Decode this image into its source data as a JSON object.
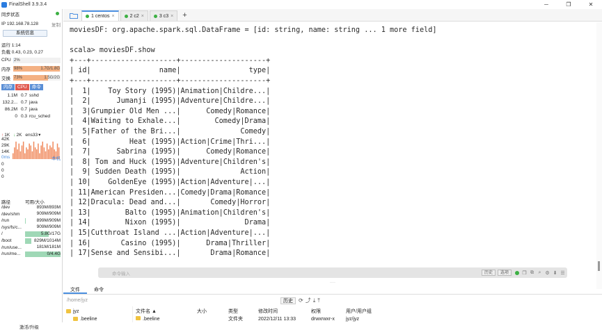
{
  "window": {
    "title": "FinalShell 3.9.3.4",
    "controls": [
      "─",
      "❐",
      "✕"
    ]
  },
  "sidebar": {
    "sync_status": "同步状态",
    "sync_dot_color": "#3cb043",
    "ip": "IP 192.168.78.128",
    "copy": "复制",
    "sysinfo_button": "系统信息",
    "uptime": "运行 1:14",
    "load": "负载 0.43, 0.23, 0.27",
    "cpu": {
      "label": "CPU",
      "value": "2%",
      "fraction": 0.02
    },
    "mem": {
      "label": "内存",
      "pct": "98%",
      "value": "1.7G/1.8G",
      "fraction": 0.98
    },
    "swap": {
      "label": "交换",
      "pct": "73%",
      "value": "1.5G/2G",
      "fraction": 0.73
    },
    "proc_tabs": [
      "内存",
      "CPU",
      "命令"
    ],
    "processes": [
      {
        "mem": "1.1M",
        "cpu": "0.7",
        "name": "sshd"
      },
      {
        "mem": "132.2...",
        "cpu": "0.7",
        "name": "java"
      },
      {
        "mem": "86.2M",
        "cpu": "0.7",
        "name": "java"
      },
      {
        "mem": "0",
        "cpu": "0.3",
        "name": "rcu_sched"
      }
    ],
    "net": {
      "up": "1K",
      "down": "2K",
      "iface": "ens33"
    },
    "net_y_labels": [
      "42K",
      "29K",
      "14K"
    ],
    "net_bars": [
      0.3,
      0.6,
      0.9,
      0.5,
      0.8,
      0.4,
      0.7,
      0.9,
      0.3,
      0.6,
      0.5,
      0.8,
      0.7,
      0.4,
      0.9,
      0.6,
      0.5,
      0.8,
      0.3,
      0.7,
      0.9,
      0.6,
      0.4,
      0.8,
      0.5,
      0.7,
      0.6,
      0.9,
      0.5,
      0.4,
      0.8,
      0.6
    ],
    "latency": {
      "value": "0ms",
      "host": "本机",
      "rows": [
        "0",
        "0",
        "0"
      ]
    },
    "disk_header": {
      "path": "路径",
      "size": "可用/大小"
    },
    "disks": [
      {
        "path": "/dev",
        "size": "893M/893M",
        "fraction": 0.0
      },
      {
        "path": "/dev/shm",
        "size": "909M/909M",
        "fraction": 0.0
      },
      {
        "path": "/run",
        "size": "899M/909M",
        "fraction": 0.01
      },
      {
        "path": "/sys/fs/c...",
        "size": "909M/909M",
        "fraction": 0.0
      },
      {
        "path": "/",
        "size": "5.8G/17G",
        "fraction": 0.66
      },
      {
        "path": "/boot",
        "size": "829M/1014M",
        "fraction": 0.18
      },
      {
        "path": "/run/use...",
        "size": "181M/181M",
        "fraction": 0.0
      },
      {
        "path": "/run/me...",
        "size": "0/4.4G",
        "fraction": 1.0
      }
    ],
    "activate": "激活/升级"
  },
  "tabs": [
    {
      "label": "1 centos",
      "active": true
    },
    {
      "label": "2 c2",
      "active": false
    },
    {
      "label": "3 c3",
      "active": false
    }
  ],
  "terminal": {
    "lines": [
      "moviesDF: org.apache.spark.sql.DataFrame = [id: string, name: string ... 1 more field]",
      "",
      "scala> moviesDF.show",
      "+---+--------------------+--------------------+",
      "| id|                name|                type|",
      "+---+--------------------+--------------------+",
      "|  1|    Toy Story (1995)|Animation|Childre...|",
      "|  2|      Jumanji (1995)|Adventure|Childre...|",
      "|  3|Grumpier Old Men ...|      Comedy|Romance|",
      "|  4|Waiting to Exhale...|        Comedy|Drama|",
      "|  5|Father of the Bri...|              Comedy|",
      "|  6|         Heat (1995)|Action|Crime|Thri...|",
      "|  7|      Sabrina (1995)|      Comedy|Romance|",
      "|  8| Tom and Huck (1995)|Adventure|Children's|",
      "|  9| Sudden Death (1995)|              Action|",
      "| 10|    GoldenEye (1995)|Action|Adventure|...|",
      "| 11|American Presiden...|Comedy|Drama|Romance|",
      "| 12|Dracula: Dead and...|       Comedy|Horror|",
      "| 13|        Balto (1995)|Animation|Children's|",
      "| 14|        Nixon (1995)|               Drama|",
      "| 15|Cutthroat Island ...|Action|Adventure|...|",
      "| 16|       Casino (1995)|      Drama|Thriller|",
      "| 17|Sense and Sensibi...|       Drama|Romance|"
    ]
  },
  "command_bar": {
    "placeholder": "命令输入",
    "history": "历史",
    "options": "选项"
  },
  "bottom_tabs": [
    "文件",
    "命令"
  ],
  "file_path": {
    "value": "/home/jyz",
    "history": "历史"
  },
  "file_tree": [
    {
      "name": "jyz"
    },
    {
      "name": ".beeline"
    }
  ],
  "file_list": {
    "headers": [
      "文件名 ▲",
      "大小",
      "类型",
      "修改时间",
      "权限",
      "用户/用户组"
    ],
    "rows": [
      [
        ".beeline",
        "",
        "文件夹",
        "2022/12/11 13:33",
        "drwxrwxr-x",
        "jyz/jyz"
      ]
    ]
  },
  "colors": {
    "mem_bar": "#f4b183",
    "swap_bar": "#f4b183",
    "cpu_bar": "#d7e7f7",
    "tab_active_accent": "#4b8fe0",
    "net_up": "#e04040",
    "net_down": "#3cb043",
    "net_chart": "#f08a5d"
  }
}
